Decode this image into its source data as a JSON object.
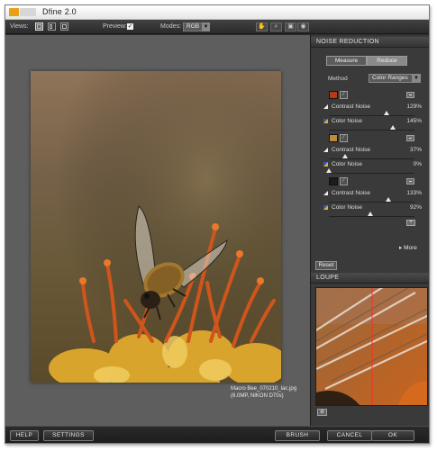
{
  "app": {
    "title": "Dfine 2.0"
  },
  "toolbar": {
    "views_label": "Views:",
    "preview_label": "Preview:",
    "preview_checked": "✓",
    "modes_label": "Modes:",
    "mode_value": "RGB"
  },
  "image": {
    "caption_line1": "Macro Bee_070210_lac.jpg",
    "caption_line2": "(6.0MP, NIKON D70s)"
  },
  "panel": {
    "header": "NOISE REDUCTION",
    "tabs": [
      "Measure",
      "Reduce"
    ],
    "method_label": "Method",
    "method_value": "Color Ranges",
    "groups": [
      {
        "swatch": "#b53a17",
        "contrast_label": "Contrast Noise",
        "contrast_value": "129%",
        "contrast_level": 0.67,
        "color_label": "Color Noise",
        "color_value": "145%",
        "color_level": 0.75
      },
      {
        "swatch": "#c08a3a",
        "contrast_label": "Contrast Noise",
        "contrast_value": "37%",
        "contrast_level": 0.19,
        "color_label": "Color Noise",
        "color_value": "0%",
        "color_level": 0.0
      },
      {
        "swatch": "#1c1c1c",
        "contrast_label": "Contrast Noise",
        "contrast_value": "133%",
        "contrast_level": 0.69,
        "color_label": "Color Noise",
        "color_value": "92%",
        "color_level": 0.48
      }
    ],
    "more_label": "More",
    "reset_label": "Reset",
    "loupe_header": "LOUPE"
  },
  "bottom": {
    "help": "HELP",
    "settings": "SETTINGS",
    "brush": "BRUSH",
    "cancel": "CANCEL",
    "ok": "OK"
  },
  "colors": {
    "accent_logo": "#e8a014",
    "panel_bg": "#3a3a3a",
    "canvas_bg": "#5e5e5e"
  }
}
